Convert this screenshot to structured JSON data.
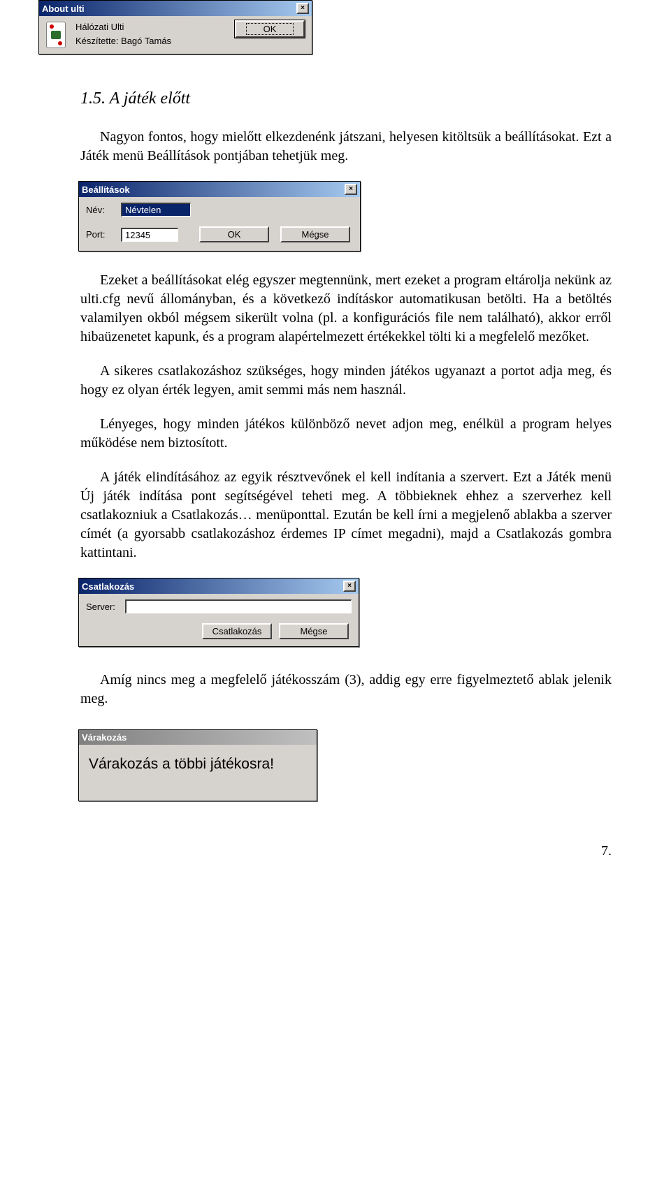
{
  "about": {
    "title": "About ulti",
    "line1": "Hálózati Ulti",
    "line2": "Készítette: Bagó Tamás",
    "ok": "OK"
  },
  "section": {
    "heading": "1.5. A játék előtt",
    "p1": "Nagyon fontos, hogy mielőtt elkezdenénk játszani, helyesen kitöltsük a beállításokat. Ezt a Játék menü Beállítások pontjában tehetjük meg."
  },
  "settings": {
    "title": "Beállítások",
    "name_label": "Név:",
    "name_value": "Névtelen",
    "port_label": "Port:",
    "port_value": "12345",
    "ok": "OK",
    "cancel": "Mégse"
  },
  "paras": {
    "p2": "Ezeket a beállításokat elég egyszer megtennünk, mert ezeket a program eltárolja nekünk az ulti.cfg nevű állományban, és a következő indításkor automatikusan betölti. Ha a betöltés valamilyen okból mégsem sikerült volna (pl. a konfigurációs file nem található), akkor erről hibaüzenetet kapunk, és a program alapértelmezett értékekkel tölti ki a megfelelő mezőket.",
    "p3": "A sikeres csatlakozáshoz szükséges, hogy minden játékos ugyanazt a portot adja meg, és hogy ez olyan érték legyen, amit semmi más nem használ.",
    "p4": "Lényeges, hogy minden játékos különböző nevet adjon meg, enélkül a program helyes működése nem biztosított.",
    "p5": "A játék elindításához az egyik résztvevőnek el kell indítania a szervert. Ezt a Játék menü Új játék indítása pont segítségével teheti meg. A többieknek ehhez a szerverhez kell csatlakozniuk a Csatlakozás… menüponttal. Ezután be kell írni a megjelenő ablakba a szerver címét (a gyorsabb csatlakozáshoz érdemes IP címet megadni), majd a Csatlakozás gombra kattintani."
  },
  "connect": {
    "title": "Csatlakozás",
    "server_label": "Server:",
    "server_value": "",
    "connect_btn": "Csatlakozás",
    "cancel": "Mégse"
  },
  "paras2": {
    "p6": "Amíg nincs meg a megfelelő játékosszám (3), addig egy erre figyelmeztető ablak jelenik meg."
  },
  "wait": {
    "title": "Várakozás",
    "message": "Várakozás a többi játékosra!"
  },
  "pagenum": "7."
}
